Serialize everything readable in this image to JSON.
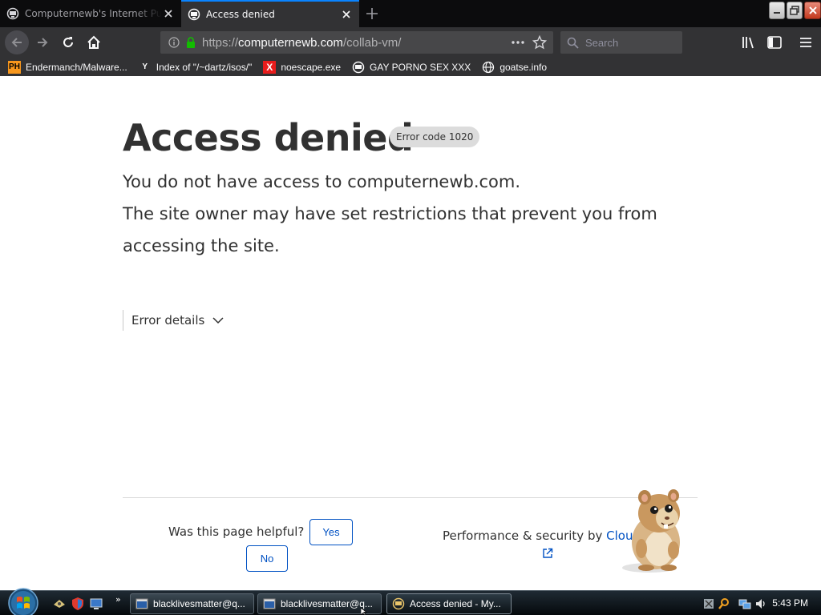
{
  "browser": {
    "tabs": [
      {
        "title": "Computernewb's Internet Pub",
        "active": false
      },
      {
        "title": "Access denied",
        "active": true
      }
    ],
    "url": {
      "scheme": "https://",
      "host": "computernewb.com",
      "path": "/collab-vm/"
    },
    "search_placeholder": "Search",
    "bookmarks": [
      {
        "label": "Endermanch/Malware...",
        "icon": "PH"
      },
      {
        "label": "Index of \"/~dartz/isos/\"",
        "icon": "Y"
      },
      {
        "label": "noescape.exe",
        "icon": "X"
      },
      {
        "label": "GAY PORNO SEX XXX",
        "icon": "cvm-icon"
      },
      {
        "label": "goatse.info",
        "icon": "globe-icon"
      }
    ]
  },
  "page": {
    "heading": "Access denied",
    "error_code": "Error code 1020",
    "desc_line1": "You do not have access to computernewb.com.",
    "desc_line2": "The site owner may have set restrictions that prevent you from accessing the site.",
    "details_label": "Error details",
    "helpful_question": "Was this page helpful?",
    "yes_label": "Yes",
    "no_label": "No",
    "perf_prefix": "Performance & security by ",
    "perf_brand": "Cloudflare"
  },
  "taskbar": {
    "buttons": [
      {
        "label": "blacklivesmatter@q...",
        "active": false
      },
      {
        "label": "blacklivesmatter@q...",
        "active": false
      },
      {
        "label": "Access denied - My...",
        "active": true
      }
    ],
    "clock": "5:43 PM"
  },
  "colors": {
    "accent": "#0a84ff",
    "link": "#0051c3",
    "text": "#313131",
    "chrome_dark": "#323234"
  }
}
